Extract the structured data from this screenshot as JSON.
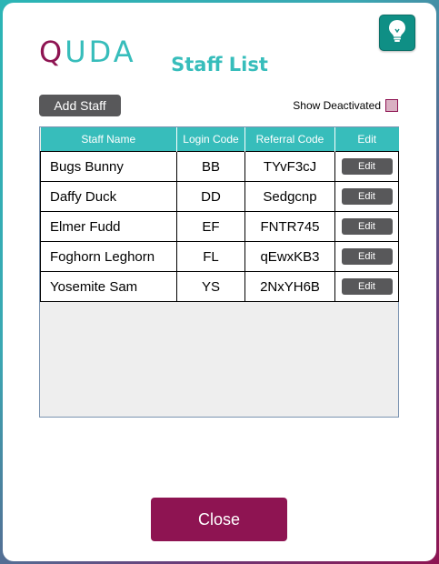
{
  "logo": {
    "first_letter": "Q",
    "rest": "UDA"
  },
  "page_title": "Staff List",
  "toolbar": {
    "add_staff_label": "Add Staff",
    "show_deactivated_label": "Show Deactivated"
  },
  "table": {
    "columns": [
      "Staff Name",
      "Login Code",
      "Referral Code",
      "Edit"
    ],
    "rows": [
      {
        "name": "Bugs Bunny",
        "login": "BB",
        "referral": "TYvF3cJ",
        "edit": "Edit"
      },
      {
        "name": "Daffy Duck",
        "login": "DD",
        "referral": "Sedgcnp",
        "edit": "Edit"
      },
      {
        "name": "Elmer Fudd",
        "login": "EF",
        "referral": "FNTR745",
        "edit": "Edit"
      },
      {
        "name": "Foghorn Leghorn",
        "login": "FL",
        "referral": "qEwxKB3",
        "edit": "Edit"
      },
      {
        "name": "Yosemite Sam",
        "login": "YS",
        "referral": "2NxYH6B",
        "edit": "Edit"
      }
    ]
  },
  "footer": {
    "close_label": "Close"
  },
  "colors": {
    "brand_teal": "#37bdbb",
    "brand_maroon": "#8e1452",
    "button_gray": "#58585a",
    "help_green": "#0f8f85"
  },
  "icons": {
    "help": "lightbulb-icon"
  }
}
